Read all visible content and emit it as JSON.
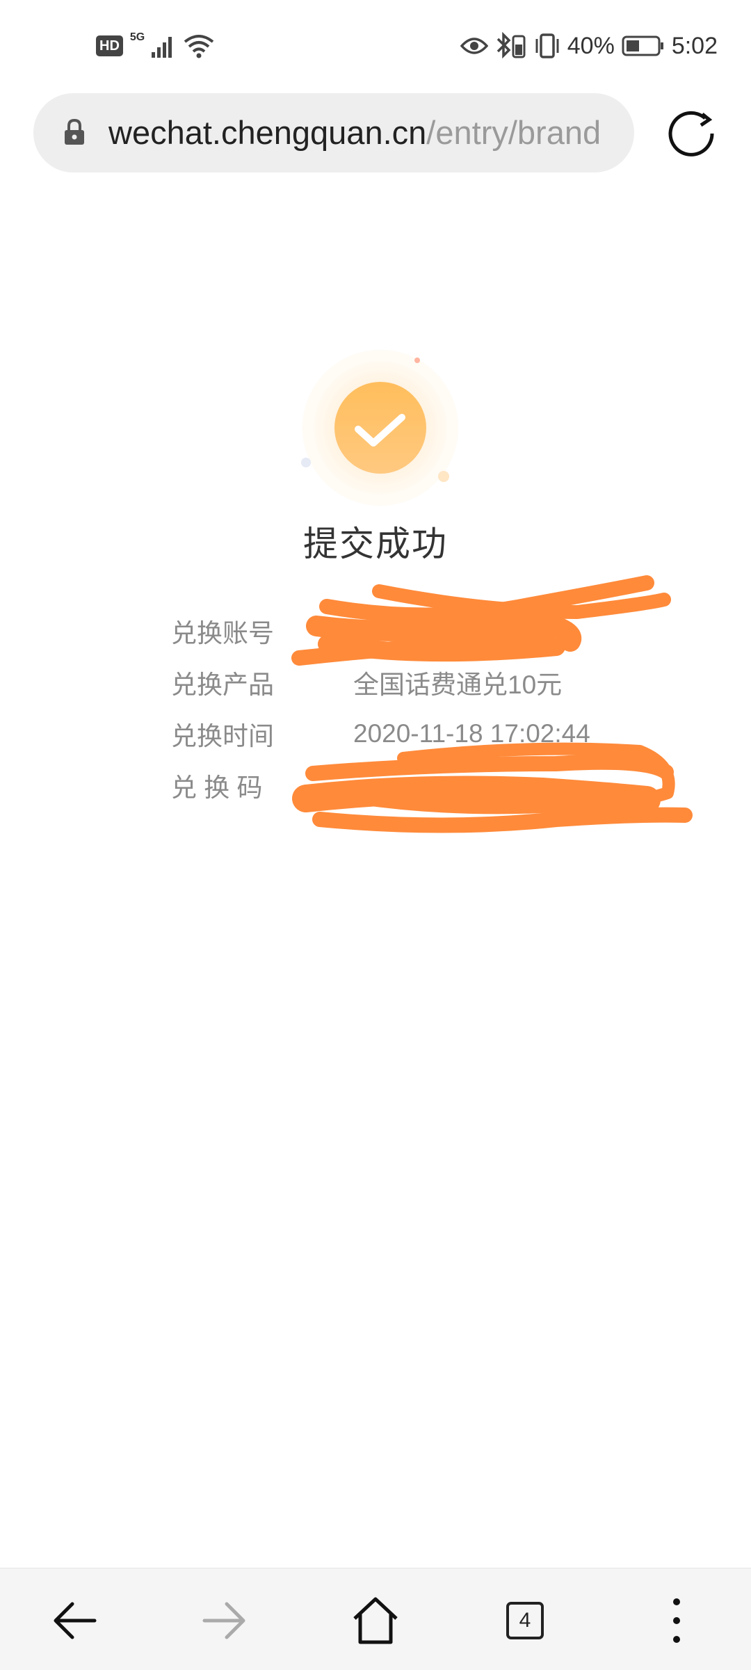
{
  "status_bar": {
    "left": {
      "hd_label": "HD",
      "network_label": "5G",
      "icons": [
        "hd-icon",
        "signal-icon",
        "wifi-icon"
      ]
    },
    "right": {
      "icons": [
        "eye-icon",
        "bluetooth-icon",
        "vibrate-icon",
        "battery-icon"
      ],
      "battery": "40%",
      "time": "5:02"
    }
  },
  "browser": {
    "url_host": "wechat.chengquan.cn",
    "url_path": "/entry/brand",
    "icons": [
      "lock-icon",
      "reload-icon"
    ]
  },
  "result": {
    "title": "提交成功",
    "icon": "check-circle-icon",
    "rows": [
      {
        "label": "兑换账号",
        "value": ""
      },
      {
        "label": "兑换产品",
        "value": "全国话费通兑10元"
      },
      {
        "label": "兑换时间",
        "value": "2020-11-18 17:02:44"
      },
      {
        "label": "兑 换 码",
        "value": ""
      }
    ]
  },
  "toolbar": {
    "tab_count": "4",
    "icons": [
      "back-arrow-icon",
      "forward-arrow-icon",
      "home-icon",
      "tabs-icon",
      "more-vertical-icon"
    ]
  },
  "colors": {
    "accent": "#ffb74d",
    "redaction": "#ff8a3a",
    "toolbar_bg": "#f5f5f5"
  }
}
